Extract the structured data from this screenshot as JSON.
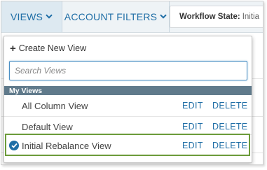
{
  "toolbar": {
    "views_label": "VIEWS",
    "account_filters_label": "ACCOUNT FILTERS",
    "workflow_state_label": "Workflow State:",
    "workflow_state_value": "Initia"
  },
  "dropdown": {
    "create_new_view_label": "Create New View",
    "search_placeholder": "Search Views",
    "section_title": "My Views",
    "views": [
      {
        "name": "All Column View",
        "edit": "EDIT",
        "delete": "DELETE",
        "selected": false
      },
      {
        "name": "Default View",
        "edit": "EDIT",
        "delete": "DELETE",
        "selected": false
      },
      {
        "name": "Initial Rebalance View",
        "edit": "EDIT",
        "delete": "DELETE",
        "selected": true
      }
    ]
  },
  "colors": {
    "accent": "#1f6ea6",
    "section_header_bg": "#607a8b",
    "highlight_border": "#6c9b3a",
    "toolbar_bg": "#eef3f6"
  },
  "icons": {
    "views_chevron": "chevron-down-icon",
    "filters_chevron": "chevron-down-icon",
    "create": "plus-icon",
    "selected": "check-circle-icon"
  }
}
